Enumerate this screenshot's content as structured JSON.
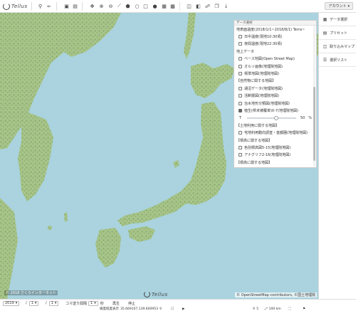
{
  "app": {
    "logo_text": "Tellus"
  },
  "toolbar": {
    "account_label": "アカウント",
    "icons": [
      "search-icon",
      "link-icon",
      "folder-image-icon",
      "layers-stack-icon",
      "move-icon",
      "zoom-in-icon",
      "zoom-out-icon",
      "line-icon",
      "polygon-icon",
      "circle-icon",
      "rectangle-icon",
      "marker-icon",
      "grid-icon",
      "text-icon",
      "window-icon",
      "panel-icon",
      "link-chain-icon",
      "copy-icon",
      "download-icon"
    ]
  },
  "panel": {
    "title": "データ選択",
    "rows": [
      {
        "type": "head",
        "label": "地表面温度(2018/1/1~2018/8/1) Terra~"
      },
      {
        "type": "check",
        "label": "日中温度(現地10:30頃)",
        "checked": false
      },
      {
        "type": "check",
        "label": "夜間温度(現地22:30頃)",
        "checked": false
      },
      {
        "type": "head",
        "label": "地上データ"
      },
      {
        "type": "check",
        "label": "ベース地図(Open Street Map)",
        "checked": false
      },
      {
        "type": "check",
        "label": "オルソ画像(地理院地図)",
        "checked": false
      },
      {
        "type": "check",
        "label": "標準地図(地理院地図)",
        "checked": false
      },
      {
        "type": "head",
        "label": "【自然物に関する地図】"
      },
      {
        "type": "check",
        "label": "湖沼データ(地理院地図)",
        "checked": false
      },
      {
        "type": "check",
        "label": "活断層図(地理院地図)",
        "checked": false
      },
      {
        "type": "check",
        "label": "治水地形分類図(地理院地図)",
        "checked": false
      },
      {
        "type": "check",
        "label": "植生(県米被覆率)0-7(地理院地図)",
        "checked": true
      },
      {
        "type": "slider",
        "label": "T",
        "value": "50",
        "unit": "%"
      },
      {
        "type": "head",
        "label": "【土地利用に関する地図】"
      },
      {
        "type": "check",
        "label": "宅地利用動向調査・首都圏(地理院地図)",
        "checked": false
      },
      {
        "type": "head",
        "label": "【標高に関する地図】"
      },
      {
        "type": "check",
        "label": "色別標高図5-15(地理院地図)",
        "checked": false
      },
      {
        "type": "check",
        "label": "アナグリフ2-16(地理院地図)",
        "checked": false
      },
      {
        "type": "head",
        "label": "【標高に関する地図】"
      }
    ],
    "opacity_fraction": 0.5
  },
  "sidebar": {
    "items": [
      {
        "icon": "data-select-icon",
        "label": "データ選択"
      },
      {
        "icon": "preset-icon",
        "label": "プリセット"
      },
      {
        "icon": "import-map-icon",
        "label": "取り込みマップ"
      },
      {
        "icon": "selection-list-icon",
        "label": "選択リスト"
      }
    ]
  },
  "map": {
    "copyright": "© 2018 さくらインターネット",
    "attribution": "© OpenStreetMap contributors, ©国土地理院",
    "logo_text": "Tellus",
    "colors": {
      "sea": "#aad3df",
      "land": "#a8c48a",
      "land_dark": "#7fa862"
    }
  },
  "bottom": {
    "year": "2019",
    "month": "1",
    "day": "1",
    "interval_label": "コマ送り間隔",
    "interval_value": "1",
    "interval_unit": "秒",
    "play_label": "再生",
    "stop_label": "停止",
    "coord_label": "緯度経度表示",
    "coord_value": "35.669107,139.600953",
    "zoom_value": "5",
    "scale_label": "100 km"
  }
}
